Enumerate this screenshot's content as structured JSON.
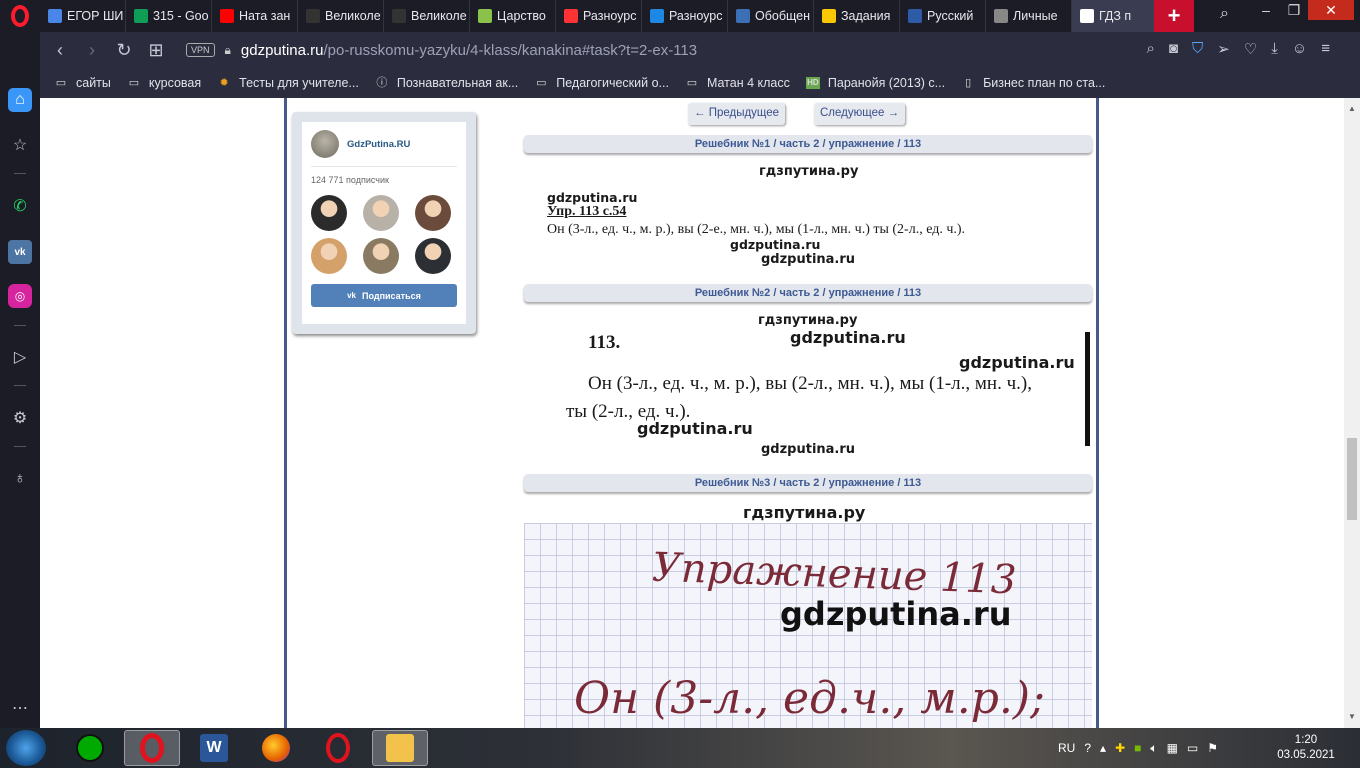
{
  "tabs": [
    {
      "label": "ЕГОР ШИ",
      "icon": "document-icon",
      "color": "#4a86e8"
    },
    {
      "label": "315 - Goo",
      "icon": "sheets-icon",
      "color": "#0f9d58"
    },
    {
      "label": "Ната зан",
      "icon": "youtube-icon",
      "color": "#ff0000"
    },
    {
      "label": "Великоле",
      "icon": "tnt-icon",
      "color": "#333333"
    },
    {
      "label": "Великоле",
      "icon": "tnt-icon",
      "color": "#333333"
    },
    {
      "label": "Царство",
      "icon": "hd-icon",
      "color": "#8bc34a"
    },
    {
      "label": "Разноурс",
      "icon": "yandex-icon",
      "color": "#f33"
    },
    {
      "label": "Разноурс",
      "icon": "check-icon",
      "color": "#1e88e5"
    },
    {
      "label": "Обобщен",
      "icon": "book-icon",
      "color": "#3b6fb6"
    },
    {
      "label": "Задания",
      "icon": "bar-icon",
      "color": "#f9c800"
    },
    {
      "label": "Русский",
      "icon": "shield-icon",
      "color": "#2e5aa8"
    },
    {
      "label": "Личные",
      "icon": "eye-icon",
      "color": "#888888"
    },
    {
      "label": "ГДЗ п",
      "icon": "flag-ru-icon",
      "color": "#ffffff"
    }
  ],
  "new_tab_symbol": "+",
  "address": {
    "vpn_label": "VPN",
    "host": "gdzputina.ru",
    "path": "/po-russkomu-yazyku/4-klass/kanakina#task?t=2-ex-113"
  },
  "bookmarks": [
    {
      "label": "сайты",
      "icon": "folder-icon"
    },
    {
      "label": "курсовая",
      "icon": "folder-icon"
    },
    {
      "label": "Тесты для учителе...",
      "icon": "bulb-icon"
    },
    {
      "label": "Познавательная ак...",
      "icon": "info-icon"
    },
    {
      "label": "Педагогический о...",
      "icon": "folder-icon"
    },
    {
      "label": "Матан 4 класс",
      "icon": "folder-icon"
    },
    {
      "label": "Паранойя (2013) с...",
      "icon": "hd-icon"
    },
    {
      "label": "Бизнес план по ста...",
      "icon": "page-icon"
    }
  ],
  "vk_widget": {
    "name": "GdzPutina.RU",
    "subscribers": "124 771 подписчик",
    "subscribe_label": "Подписаться",
    "vk_logo": "vk",
    "face_colors": [
      "#2b2b2b",
      "#b7b1a8",
      "#6b4b3c",
      "#d4a16a",
      "#8a7a62",
      "#2c2f33"
    ]
  },
  "pager": {
    "prev": "← Предыдущее",
    "next": "Следующее →"
  },
  "solutions": [
    {
      "header": "Решебник №1 / часть 2 / упражнение / 113"
    },
    {
      "header": "Решебник №2 / часть 2 / упражнение / 113"
    },
    {
      "header": "Решебник №3 / часть 2 / упражнение / 113"
    }
  ],
  "sol1": {
    "wm_top": "гдзпутина.ру",
    "wm_small": "gdzputina.ru",
    "title": "Упр. 113 с.54",
    "text": "Он (3-л., ед. ч., м. р.),  вы (2-е., мн. ч.),  мы (1-л., мн. ч.) ты (2-л., ед. ч.).",
    "wm_mid": "gdzputina.ru",
    "wm_bottom": "gdzputina.ru"
  },
  "sol2": {
    "wm_top": "гдзпутина.ру",
    "wm_1": "gdzputina.ru",
    "number": "113.",
    "wm_2": "gdzputina.ru",
    "line1": "Он (3-л., ед. ч., м. р.), вы (2-л., мн. ч.), мы (1-л., мн. ч.),",
    "line2": "ты (2-л., ед. ч.).",
    "wm_3": "gdzputina.ru",
    "wm_bottom": "gdzputina.ru"
  },
  "sol3": {
    "wm_top": "гдзпутина.ру",
    "hand_title": "Упражнение 113",
    "wm_big": "gdzputina.ru",
    "hand_line": "Он (3-л., ед.ч., м.р.);"
  },
  "taskbar": {
    "lang": "RU",
    "time": "1:20",
    "date": "03.05.2021"
  }
}
